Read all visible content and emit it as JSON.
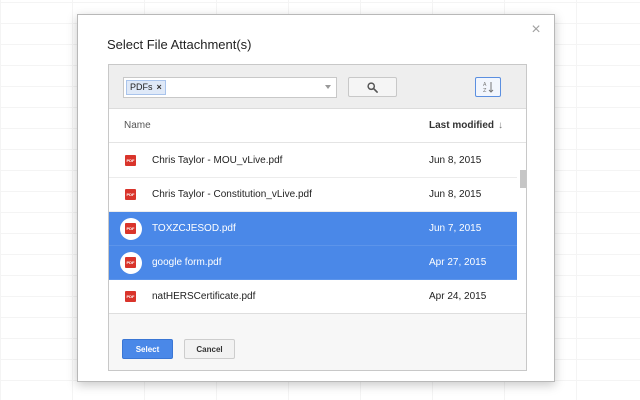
{
  "dialog": {
    "title": "Select File Attachment(s)",
    "close_glyph": "×"
  },
  "search": {
    "filter_chip": "PDFs",
    "chip_remove_glyph": "×",
    "placeholder": ""
  },
  "columns": {
    "name": "Name",
    "last_modified": "Last modified",
    "sort_glyph": "↓"
  },
  "files": [
    {
      "name": "Chris Taylor - MOU_vLive.pdf",
      "date": "Jun 8, 2015",
      "selected": false
    },
    {
      "name": "Chris Taylor - Constitution_vLive.pdf",
      "date": "Jun 8, 2015",
      "selected": false
    },
    {
      "name": "TOXZCJESOD.pdf",
      "date": "Jun 7, 2015",
      "selected": true
    },
    {
      "name": "google form.pdf",
      "date": "Apr 27, 2015",
      "selected": true
    },
    {
      "name": "natHERSCertificate.pdf",
      "date": "Apr 24, 2015",
      "selected": false
    }
  ],
  "file_icon_label": "PDF",
  "buttons": {
    "select": "Select",
    "cancel": "Cancel"
  },
  "colors": {
    "accent": "#4a88e8",
    "pdf_icon": "#d9342b"
  }
}
